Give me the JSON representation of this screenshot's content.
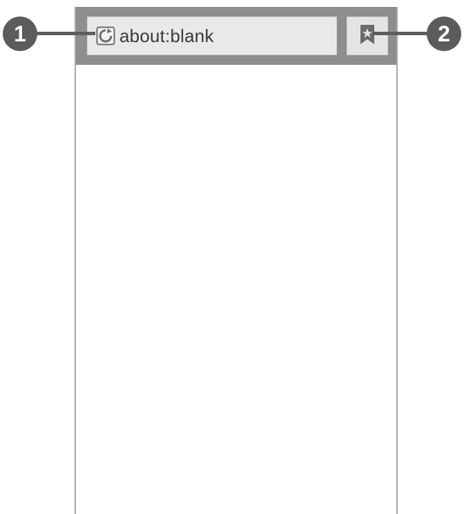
{
  "browser": {
    "url": "about:blank",
    "favicon_icon": "globe-refresh-icon",
    "bookmark_icon": "bookmark-star-icon"
  },
  "callouts": {
    "first": "1",
    "second": "2"
  }
}
